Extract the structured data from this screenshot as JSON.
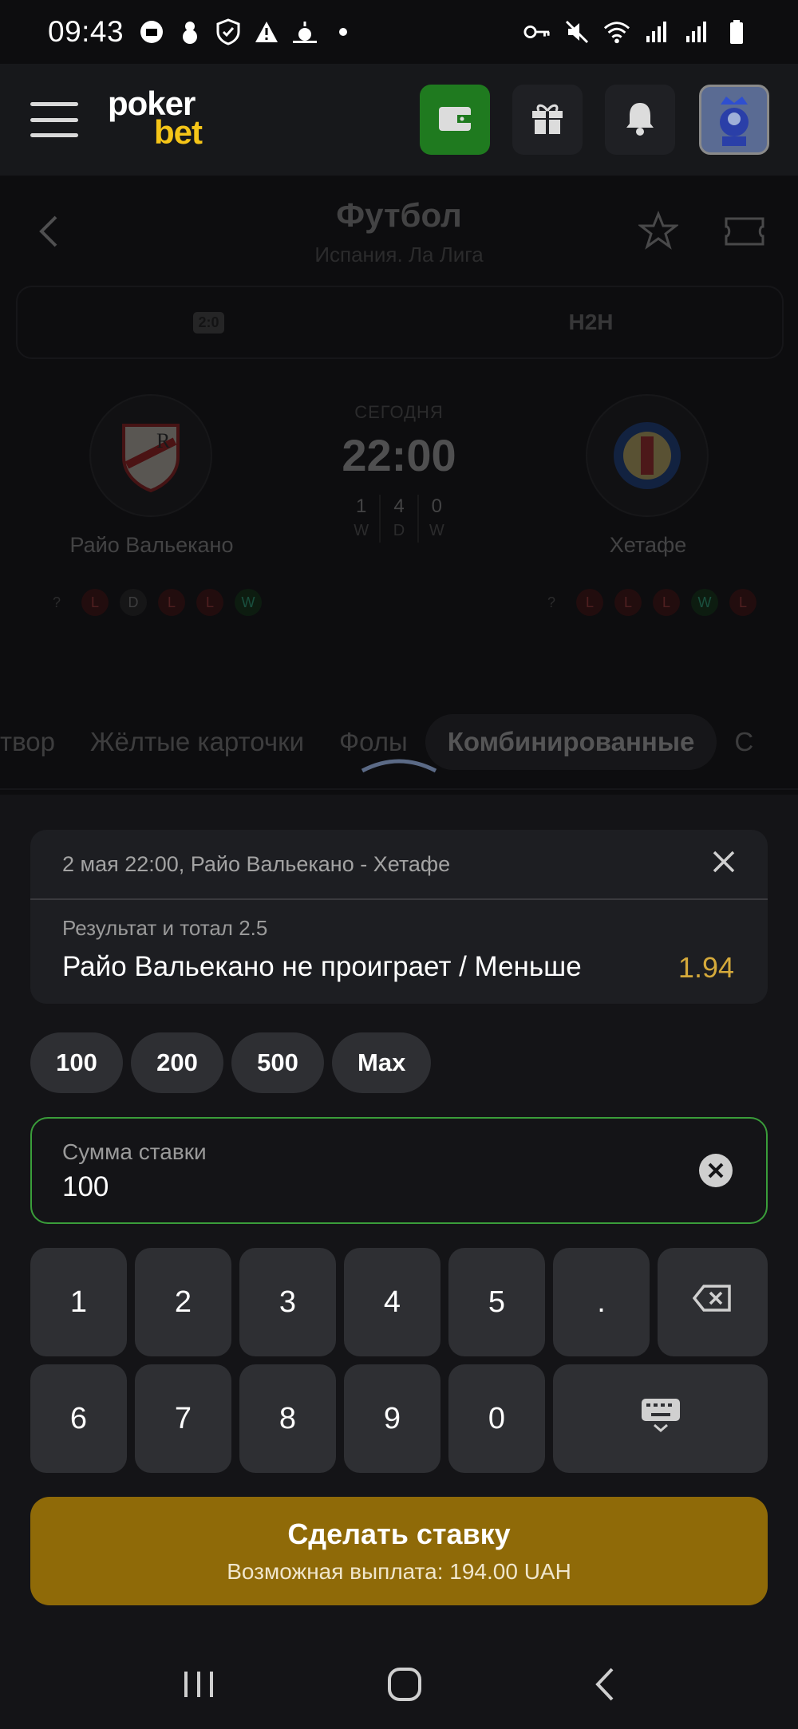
{
  "status_bar": {
    "time": "09:43"
  },
  "header": {
    "logo_line1": "poker",
    "logo_line2": "bet"
  },
  "match_header": {
    "title": "Футбол",
    "subtitle": "Испания. Ла Лига",
    "segments": [
      {
        "chip": "2:0"
      },
      {
        "label": "H2H"
      }
    ]
  },
  "match": {
    "home": {
      "name": "Райо Вальекано",
      "form": [
        "?",
        "L",
        "D",
        "L",
        "L",
        "W"
      ]
    },
    "away": {
      "name": "Хетафе",
      "form": [
        "?",
        "L",
        "L",
        "L",
        "W",
        "L"
      ]
    },
    "day_label": "СЕГОДНЯ",
    "kickoff": "22:00",
    "h2h": [
      {
        "value": "1",
        "code": "W"
      },
      {
        "value": "4",
        "code": "D"
      },
      {
        "value": "0",
        "code": "W"
      }
    ]
  },
  "market_tabs": [
    "твор",
    "Жёлтые карточки",
    "Фолы",
    "Комбинированные",
    "С"
  ],
  "active_market_tab": "Комбинированные",
  "betslip": {
    "event": "2 мая 22:00, Райо Вальекано - Хетафе",
    "market": "Результат и тотал 2.5",
    "selection": "Райо Вальекано не проиграет / Меньше",
    "odds": "1.94",
    "quick_amounts": [
      "100",
      "200",
      "500",
      "Max"
    ],
    "stake_label": "Сумма ставки",
    "stake_value": "100",
    "keypad_row1": [
      "1",
      "2",
      "3",
      "4",
      "5",
      "."
    ],
    "keypad_row2": [
      "6",
      "7",
      "8",
      "9",
      "0"
    ],
    "submit_label": "Сделать ставку",
    "payout_text": "Возможная выплата: 194.00 UAH"
  },
  "icons": {
    "menu": "hamburger-icon",
    "wallet": "wallet-icon",
    "gift": "gift-icon",
    "bell": "bell-icon",
    "back": "chevron-left-icon",
    "favorite": "star-icon",
    "ticket": "ticket-icon",
    "close": "close-icon",
    "clear": "clear-circle-icon",
    "backspace": "backspace-icon",
    "keyboard": "keyboard-icon"
  },
  "colors": {
    "accent_gold": "#d4a93b",
    "submit_bg": "#8f6a08",
    "wallet_green": "#1f7a1f",
    "focus_green": "#3a9d3a"
  }
}
